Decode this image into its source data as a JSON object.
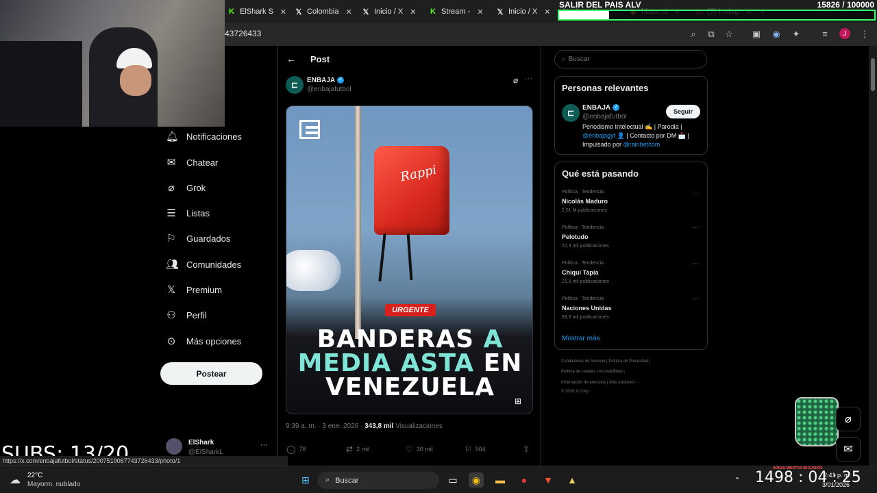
{
  "browser": {
    "tabs": [
      {
        "label": "ElShark S",
        "icon": "kick-icon"
      },
      {
        "label": "Colombia",
        "icon": "x-logo-icon"
      },
      {
        "label": "Inicio / X",
        "icon": "x-logo-icon"
      },
      {
        "label": "Stream -",
        "icon": "kick-icon"
      },
      {
        "label": "Inicio / X",
        "icon": "x-logo-icon"
      },
      {
        "label": "Aver V",
        "icon": "x-logo-icon"
      },
      {
        "label": "blaze.st",
        "icon": "blaze-icon"
      },
      {
        "label": "(3) Instag",
        "icon": "instagram-icon"
      }
    ],
    "url": "43726433",
    "profile_initial": "J"
  },
  "stream": {
    "goal_title": "SALIR DEL PAIS ALV",
    "goal_count": "15826 / 100000",
    "goal_progress": 0.158,
    "subs": "SUBS: 13/20",
    "timer": "1498 : 04 : 25",
    "timer_labels": "HORAS   MINUTOS   SEGUNDOS"
  },
  "nav": {
    "items": [
      {
        "label": "Notificaciones",
        "icon": "bell-icon"
      },
      {
        "label": "Chatear",
        "icon": "mail-icon"
      },
      {
        "label": "Grok",
        "icon": "grok-icon"
      },
      {
        "label": "Listas",
        "icon": "list-icon"
      },
      {
        "label": "Guardados",
        "icon": "bookmark-icon"
      },
      {
        "label": "Comunidades",
        "icon": "people-icon"
      },
      {
        "label": "Premium",
        "icon": "x-logo-icon"
      },
      {
        "label": "Perfil",
        "icon": "person-icon"
      },
      {
        "label": "Más opciones",
        "icon": "more-circle-icon"
      }
    ],
    "post_button": "Postear",
    "account_name": "ElShark",
    "account_handle": "@ElSharkL"
  },
  "post": {
    "header_title": "Post",
    "author_name": "ENBAJA",
    "author_handle": "@enbajafutbol",
    "badge": "URGENTE",
    "headline_line1_a": "BANDERAS",
    "headline_line1_b": "A",
    "headline_line2_a": "MEDIA ASTA",
    "headline_line2_b": "EN",
    "headline_line3": "VENEZUELA",
    "bag_logo": "Rappi",
    "time": "9:39 a. m. · 3 ene. 2026 · ",
    "views_count": "343,8 mil",
    "views_label": " Visualizaciones",
    "replies": "78",
    "reposts": "2 mil",
    "likes": "30 mil",
    "bookmarks": "504"
  },
  "sidebar": {
    "search_placeholder": "Buscar",
    "relevant_title": "Personas relevantes",
    "relevant_name": "ENBAJA",
    "relevant_handle": "@enbajafutbol",
    "follow_label": "Seguir",
    "bio_line1": "Periodismo Intelectual ✍️ | Parodia |",
    "bio_line2_mention": "@enbajagyt",
    "bio_line2_rest": " 👤 | Contacto por DM 📩 |",
    "bio_line3_text": "Impulsado por ",
    "bio_line3_mention": "@rainbetcom",
    "trends_title": "Qué está pasando",
    "trends": [
      {
        "category": "Política · Tendencia",
        "name": "Nicolás Maduro",
        "count": "2,01 M publicaciones"
      },
      {
        "category": "Política · Tendencia",
        "name": "Pelotudo",
        "count": "27,4 mil publicaciones"
      },
      {
        "category": "Política · Tendencia",
        "name": "Chiqui Tapia",
        "count": "21,8 mil publicaciones"
      },
      {
        "category": "Política · Tendencia",
        "name": "Naciones Unidas",
        "count": "68,3 mil publicaciones"
      }
    ],
    "show_more": "Mostrar más",
    "footer": [
      "Condiciones de Servicio  |  Política de Privacidad  |",
      "Política de cookies  |  Accesibilidad  |",
      "Información de anuncios  |  Más opciones ···",
      "© 2026 X Corp."
    ]
  },
  "statusbar": "https://x.com/enbajafutbol/status/2007519067743726433/photo/1",
  "taskbar": {
    "weather_temp": "22°C",
    "weather_desc": "Mayorm. nublado",
    "search_label": "Buscar",
    "clock_time": "2:41 p. m.",
    "clock_date": "3/01/2026"
  }
}
